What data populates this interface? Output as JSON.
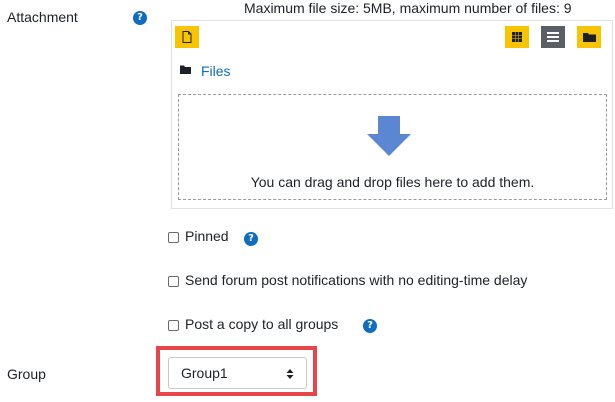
{
  "attachment": {
    "label": "Attachment",
    "max_info": "Maximum file size: 5MB, maximum number of files: 9",
    "files_path": "Files",
    "dropzone_text": "You can drag and drop files here to add them."
  },
  "options": {
    "pinned": "Pinned",
    "send_notifications": "Send forum post notifications with no editing-time delay",
    "post_copy": "Post a copy to all groups"
  },
  "group": {
    "label": "Group",
    "selected": "Group1"
  },
  "help_icon_glyph": "?",
  "colors": {
    "accent_yellow": "#f7c400",
    "help_blue": "#0f6cbf",
    "arrow_blue": "#5b86d2",
    "highlight_red": "#e8454a"
  }
}
